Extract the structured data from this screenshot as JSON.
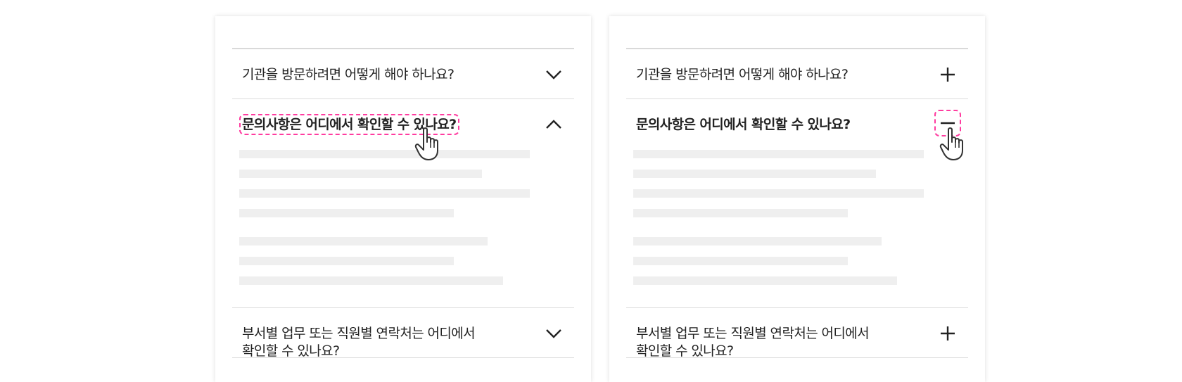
{
  "accent_color": "#ff3ca0",
  "placeholder_bar_color": "#efefef",
  "left_panel": {
    "variant": "chevron",
    "items": [
      {
        "question": "기관을 방문하려면 어떻게 해야 하나요?",
        "expanded": false,
        "icon": "chevron-down-icon"
      },
      {
        "question": "문의사항은 어디에서 확인할 수 있나요?",
        "expanded": true,
        "icon": "chevron-up-icon",
        "focused_element": "question"
      },
      {
        "question_line1": "부서별 업무 또는 직원별 연락처는 어디에서",
        "question_line2": "확인할 수 있나요?",
        "expanded": false,
        "icon": "chevron-down-icon"
      }
    ]
  },
  "right_panel": {
    "variant": "plus-minus",
    "items": [
      {
        "question": "기관을 방문하려면 어떻게 해야 하나요?",
        "expanded": false,
        "icon": "plus-icon"
      },
      {
        "question": "문의사항은 어디에서 확인할 수 있나요?",
        "expanded": true,
        "icon": "minus-icon",
        "focused_element": "icon"
      },
      {
        "question_line1": "부서별 업무 또는 직원별 연락처는 어디에서",
        "question_line2": "확인할 수 있나요?",
        "expanded": false,
        "icon": "plus-icon"
      }
    ]
  }
}
